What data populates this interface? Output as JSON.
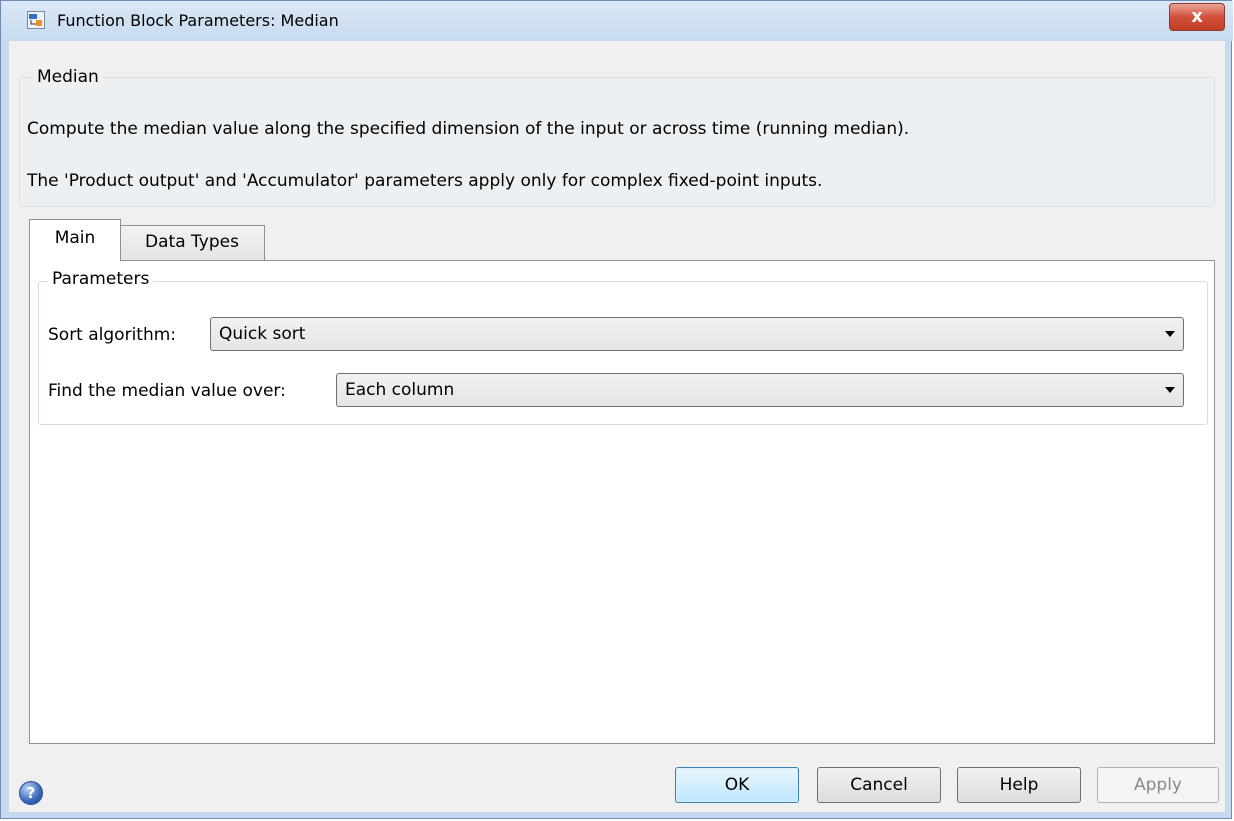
{
  "window": {
    "title": "Function Block Parameters: Median",
    "icon": "simulink-block-icon",
    "close_glyph": "x"
  },
  "description": {
    "group_title": "Median",
    "line1": "Compute the median value along the specified dimension of the input or across time (running median).",
    "line2": "The 'Product output' and 'Accumulator' parameters apply only for complex fixed-point inputs."
  },
  "tabs": [
    {
      "label": "Main",
      "selected": true
    },
    {
      "label": "Data Types",
      "selected": false
    }
  ],
  "parameters": {
    "group_title": "Parameters",
    "sort_algorithm": {
      "label": "Sort algorithm:",
      "value": "Quick sort"
    },
    "median_over": {
      "label": "Find the median value over:",
      "value": "Each column"
    }
  },
  "buttons": {
    "ok": "OK",
    "cancel": "Cancel",
    "help": "Help",
    "apply": "Apply"
  },
  "help_icon_glyph": "?"
}
